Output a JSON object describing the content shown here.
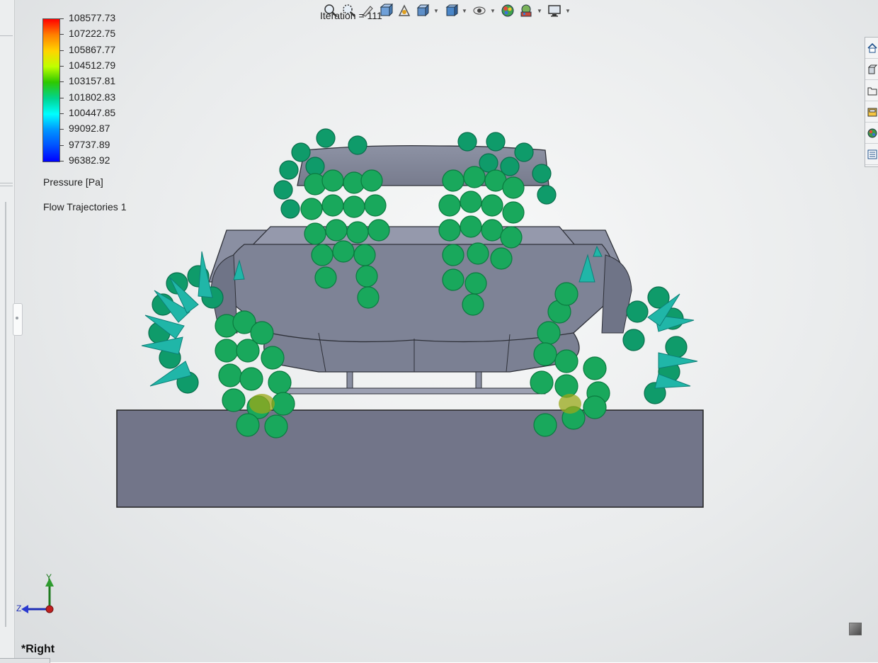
{
  "legend": {
    "values": [
      "108577.73",
      "107222.75",
      "105867.77",
      "104512.79",
      "103157.81",
      "101802.83",
      "100447.85",
      "99092.87",
      "97737.89",
      "96382.92"
    ],
    "colors": [
      "#ff0000",
      "#ff7f00",
      "#ffd400",
      "#bfff00",
      "#2ec800",
      "#00d48f",
      "#00ffff",
      "#0096ff",
      "#0050ff",
      "#0000ff"
    ],
    "parameter": "Pressure [Pa]",
    "plot_name": "Flow Trajectories 1"
  },
  "status": {
    "iteration": "Iteration = 111"
  },
  "view": {
    "name": "*Right",
    "triad": {
      "y": "Y",
      "z": "Z"
    }
  },
  "heads_up_toolbar": {
    "icons": [
      "zoom-to-fit-icon",
      "zoom-to-area-icon",
      "previous-view-icon",
      "section-view-icon",
      "dynamic-annotation-icon",
      "view-orientation-icon",
      "display-style-icon",
      "hide-show-items-icon",
      "edit-appearance-icon",
      "apply-scene-icon",
      "view-settings-icon"
    ]
  },
  "task_pane": {
    "icons": [
      "home-icon",
      "3d-parts-icon",
      "folder-icon",
      "view-palette-icon",
      "appearances-icon",
      "custom-properties-icon"
    ]
  }
}
